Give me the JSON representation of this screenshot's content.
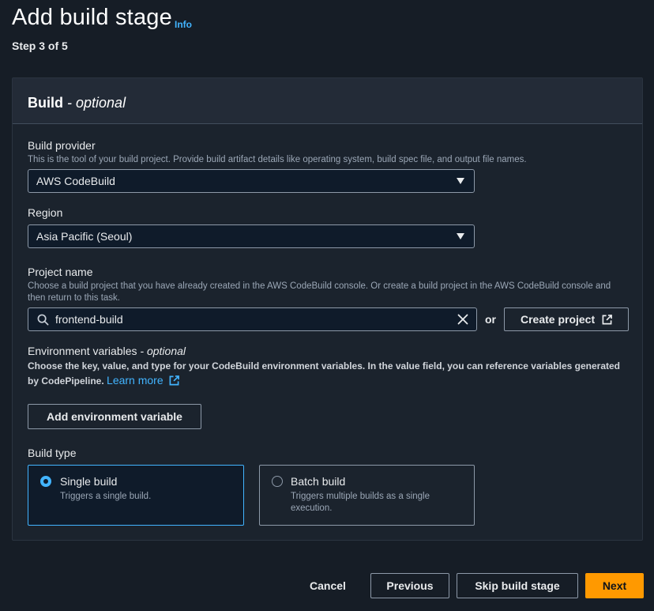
{
  "header": {
    "title": "Add build stage",
    "info": "Info",
    "step": "Step 3 of 5"
  },
  "panel": {
    "title": "Build",
    "title_suffix": "- optional"
  },
  "build_provider": {
    "label": "Build provider",
    "description": "This is the tool of your build project. Provide build artifact details like operating system, build spec file, and output file names.",
    "value": "AWS CodeBuild"
  },
  "region": {
    "label": "Region",
    "value": "Asia Pacific (Seoul)"
  },
  "project_name": {
    "label": "Project name",
    "description": "Choose a build project that you have already created in the AWS CodeBuild console. Or create a build project in the AWS CodeBuild console and then return to this task.",
    "value": "frontend-build",
    "or": "or",
    "create_label": "Create project"
  },
  "env_vars": {
    "label": "Environment variables",
    "label_suffix": "- optional",
    "description": "Choose the key, value, and type for your CodeBuild environment variables. In the value field, you can reference variables generated by CodePipeline.",
    "learn_more": "Learn more",
    "add_label": "Add environment variable"
  },
  "build_type": {
    "label": "Build type",
    "options": [
      {
        "title": "Single build",
        "description": "Triggers a single build.",
        "selected": true
      },
      {
        "title": "Batch build",
        "description": "Triggers multiple builds as a single execution.",
        "selected": false
      }
    ]
  },
  "footer": {
    "cancel": "Cancel",
    "previous": "Previous",
    "skip": "Skip build stage",
    "next": "Next"
  },
  "colors": {
    "background": "#161d26",
    "panel": "#1b232d",
    "accent": "#42b4ff",
    "primary": "#ff9900"
  }
}
